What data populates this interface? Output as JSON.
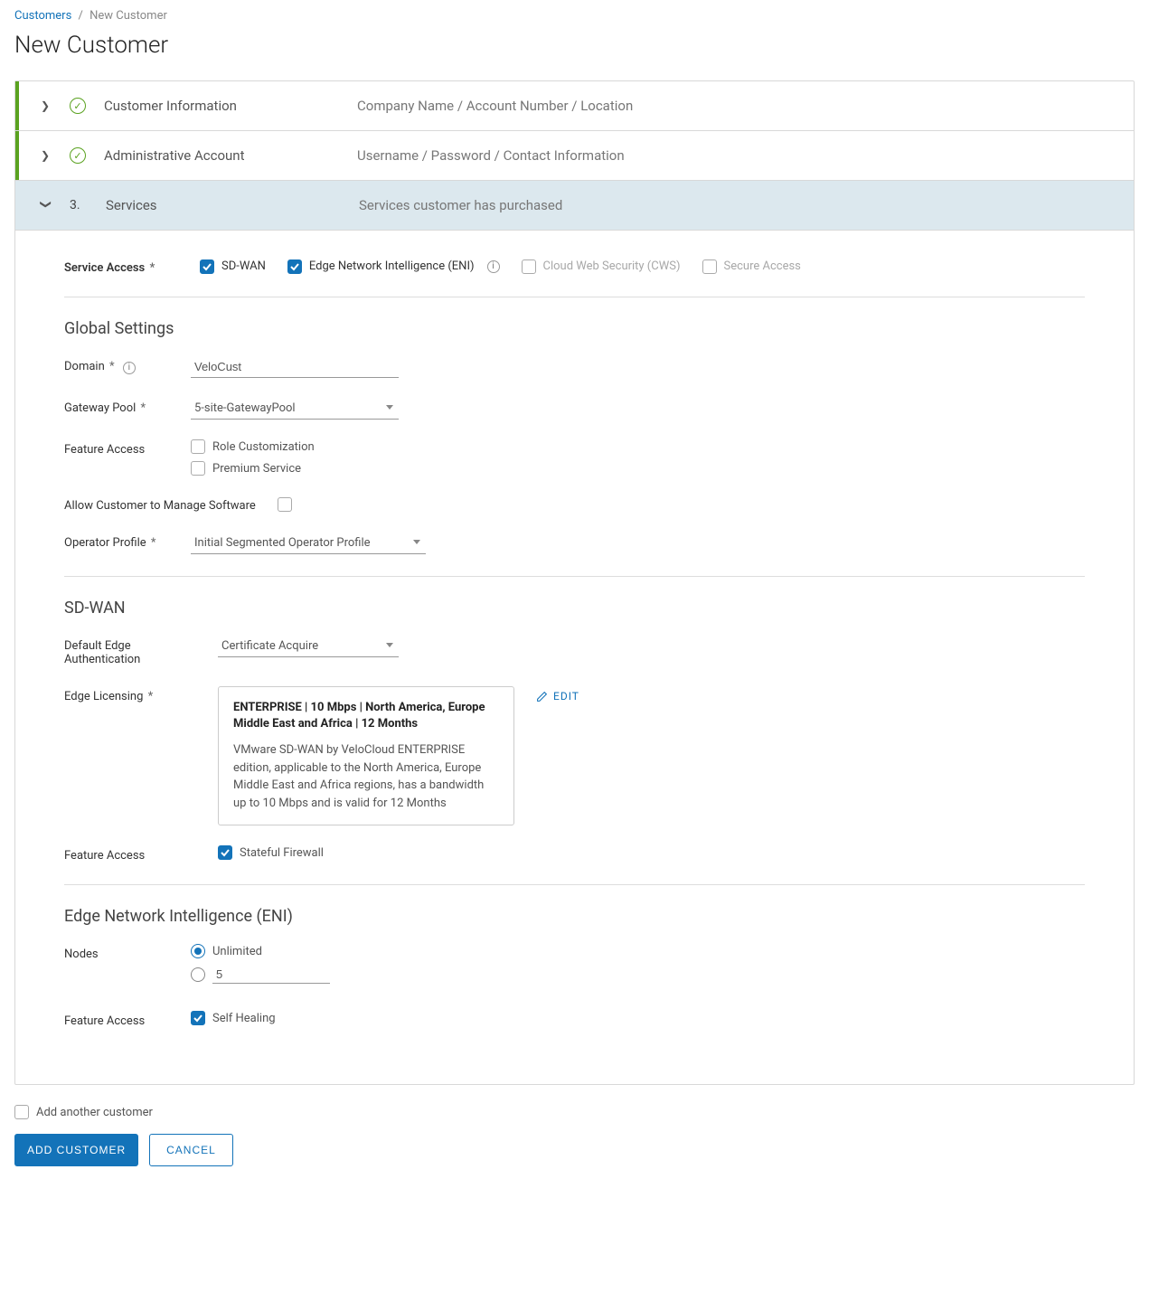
{
  "breadcrumb": {
    "root": "Customers",
    "current": "New Customer"
  },
  "page_title": "New Customer",
  "steps": [
    {
      "title": "Customer Information",
      "desc": "Company Name / Account Number / Location"
    },
    {
      "title": "Administrative Account",
      "desc": "Username / Password / Contact Information"
    },
    {
      "number": "3.",
      "title": "Services",
      "desc": "Services customer has purchased"
    }
  ],
  "service_access": {
    "label": "Service Access",
    "options": {
      "sdwan": "SD-WAN",
      "eni": "Edge Network Intelligence (ENI)",
      "cws": "Cloud Web Security (CWS)",
      "secure": "Secure Access"
    }
  },
  "global": {
    "heading": "Global Settings",
    "domain_label": "Domain",
    "domain_value": "VeloCust",
    "gateway_label": "Gateway Pool",
    "gateway_value": "5-site-GatewayPool",
    "feature_label": "Feature Access",
    "role_custom": "Role Customization",
    "premium": "Premium Service",
    "allow_manage": "Allow Customer to Manage Software",
    "op_profile_label": "Operator Profile",
    "op_profile_value": "Initial Segmented Operator Profile"
  },
  "sdwan": {
    "heading": "SD-WAN",
    "default_edge_label": "Default Edge Authentication",
    "default_edge_value": "Certificate Acquire",
    "edge_lic_label": "Edge Licensing",
    "edit": "EDIT",
    "lic_title": "ENTERPRISE | 10 Mbps | North America, Europe Middle East and Africa | 12 Months",
    "lic_desc": "VMware SD-WAN by VeloCloud ENTERPRISE edition, applicable to the North America, Europe Middle East and Africa regions, has a bandwidth up to 10 Mbps and is valid for 12 Months",
    "feature_label": "Feature Access",
    "stateful_fw": "Stateful Firewall"
  },
  "eni": {
    "heading": "Edge Network Intelligence (ENI)",
    "nodes_label": "Nodes",
    "unlimited": "Unlimited",
    "custom_value": "5",
    "feature_label": "Feature Access",
    "self_healing": "Self Healing"
  },
  "footer": {
    "add_another": "Add another customer",
    "add_btn": "ADD CUSTOMER",
    "cancel_btn": "CANCEL"
  }
}
